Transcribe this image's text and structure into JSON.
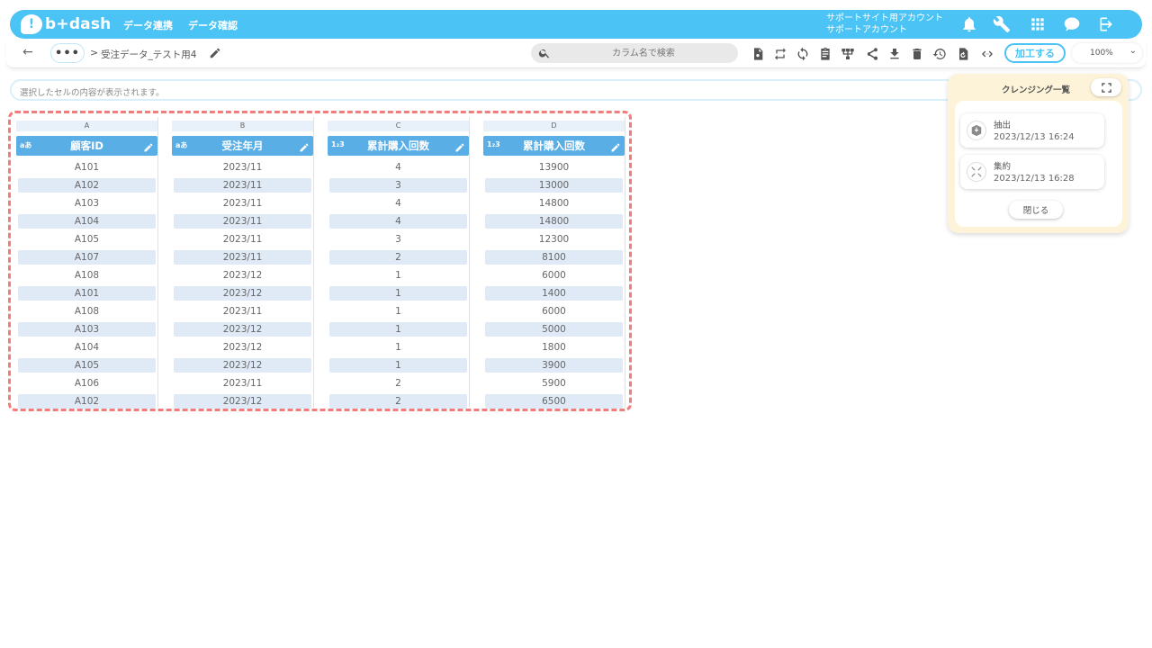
{
  "app": {
    "logo_text": "b+dash",
    "nav": [
      "データ連携",
      "データ確認"
    ],
    "account_line1": "サポートサイト用アカウント",
    "account_line2": "サポートアカウント"
  },
  "toolbar": {
    "back": "←",
    "more": "•••",
    "separator": ">",
    "title": "受注データ_テスト用4",
    "search_placeholder": "カラム名で検索",
    "process_label": "加工する",
    "zoom_value": "100%",
    "tools": [
      "settings-file-icon",
      "swap-icon",
      "refresh-icon",
      "clipboard-icon",
      "hierarchy-icon",
      "share-icon",
      "download-icon",
      "delete-icon",
      "history-icon",
      "restore-file-icon",
      "code-icon"
    ]
  },
  "cellbar": {
    "placeholder": "選択したセルの内容が表示されます。"
  },
  "grid": {
    "columns": [
      {
        "letter": "A",
        "type": "aあ",
        "name": "顧客ID",
        "values": [
          "A101",
          "A102",
          "A103",
          "A104",
          "A105",
          "A107",
          "A108",
          "A101",
          "A108",
          "A103",
          "A104",
          "A105",
          "A106",
          "A102"
        ]
      },
      {
        "letter": "B",
        "type": "aあ",
        "name": "受注年月",
        "values": [
          "2023/11",
          "2023/11",
          "2023/11",
          "2023/11",
          "2023/11",
          "2023/11",
          "2023/12",
          "2023/12",
          "2023/11",
          "2023/12",
          "2023/12",
          "2023/12",
          "2023/11",
          "2023/12"
        ]
      },
      {
        "letter": "C",
        "type": "1₂3",
        "name": "累計購入回数",
        "values": [
          "4",
          "3",
          "4",
          "4",
          "3",
          "2",
          "1",
          "1",
          "1",
          "1",
          "1",
          "1",
          "2",
          "2"
        ]
      },
      {
        "letter": "D",
        "type": "1₂3",
        "name": "累計購入回数",
        "values": [
          "13900",
          "13000",
          "14800",
          "14800",
          "12300",
          "8100",
          "6000",
          "1400",
          "6000",
          "5000",
          "1800",
          "3900",
          "5900",
          "6500"
        ]
      }
    ]
  },
  "cleansing": {
    "title": "クレンジング一覧",
    "steps": [
      {
        "name": "抽出",
        "time": "2023/12/13 16:24",
        "icon": "extract-icon"
      },
      {
        "name": "集約",
        "time": "2023/12/13 16:28",
        "icon": "aggregate-icon"
      }
    ],
    "close_label": "閉じる"
  },
  "colors": {
    "brand": "#4cc3f5",
    "header_cell": "#5aaee6",
    "alt_row": "#dfeaf6",
    "highlight": "#f07c7c",
    "panel": "#fdf3d8"
  }
}
